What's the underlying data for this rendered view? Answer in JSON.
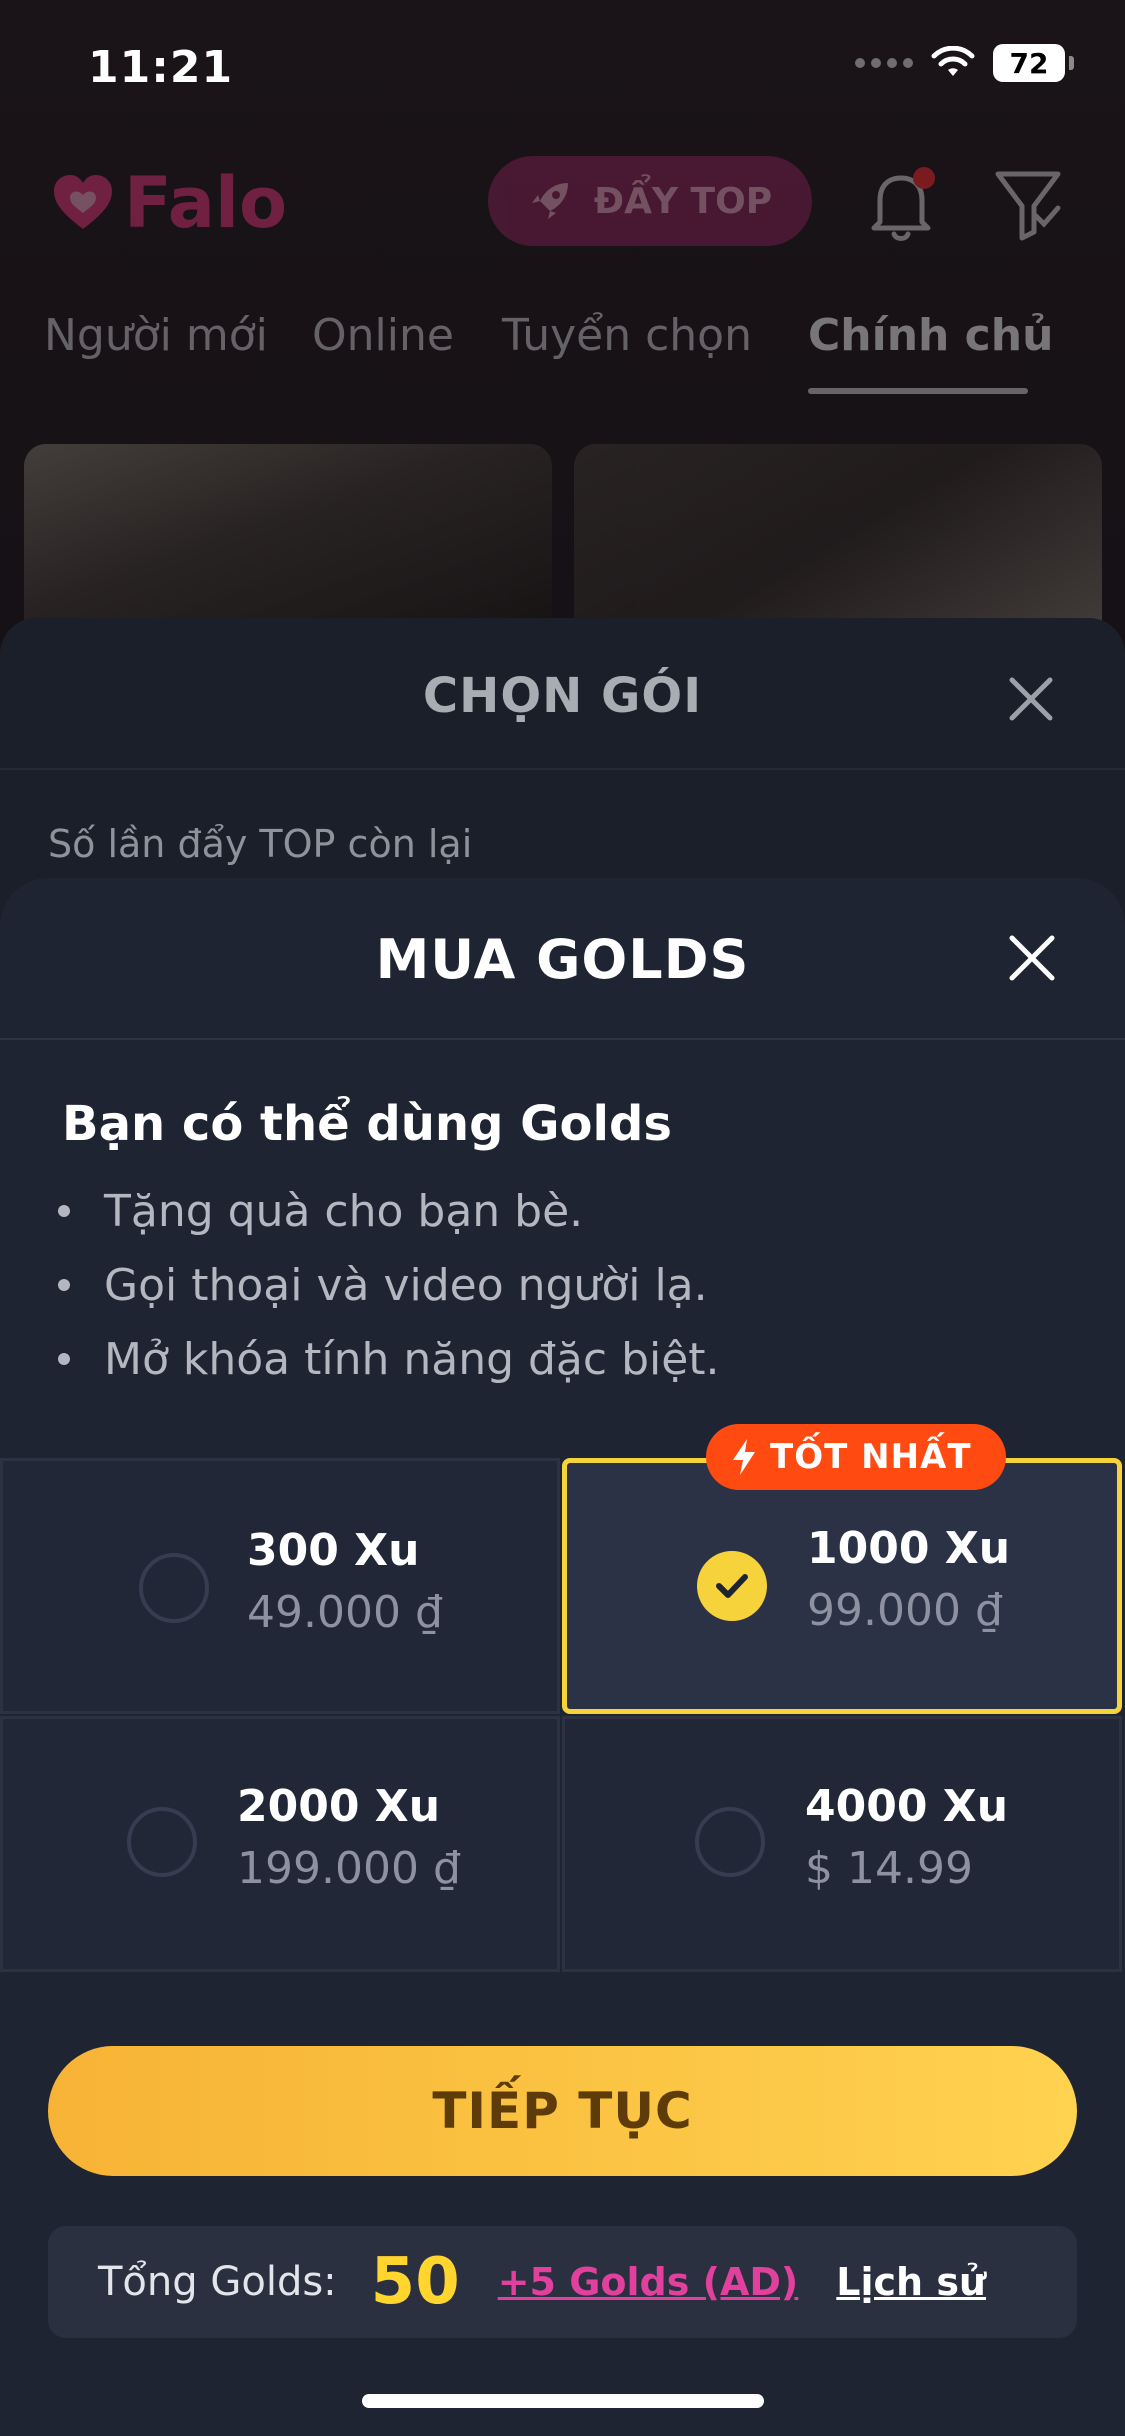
{
  "status_bar": {
    "time": "11:21",
    "battery": "72"
  },
  "app": {
    "logo_text": "Falo",
    "push_top_label": "ĐẨY TOP",
    "tabs": [
      {
        "label": "Người mới"
      },
      {
        "label": "Online"
      },
      {
        "label": "Tuyển chọn"
      },
      {
        "label": "Chính chủ",
        "active": true
      }
    ]
  },
  "choose_package_sheet": {
    "title": "CHỌN GÓI",
    "subtitle": "Số lần đẩy TOP còn lại"
  },
  "buy_golds_sheet": {
    "title": "MUA GOLDS",
    "benefits_title": "Bạn có thể dùng Golds",
    "benefits": [
      "Tặng quà cho bạn bè.",
      "Gọi thoại và video người lạ.",
      "Mở khóa tính năng đặc biệt."
    ],
    "packages": [
      {
        "amount": "300 Xu",
        "price": "49.000 ₫",
        "selected": false
      },
      {
        "amount": "1000 Xu",
        "price": "99.000 ₫",
        "selected": true,
        "badge": "TỐT NHẤT"
      },
      {
        "amount": "2000 Xu",
        "price": "199.000 ₫",
        "selected": false
      },
      {
        "amount": "4000 Xu",
        "price": "$ 14.99",
        "selected": false
      }
    ],
    "continue_label": "TIẾP TỤC",
    "total_label": "Tổng Golds:",
    "total_value": "50",
    "ad_link": "+5 Golds (AD)",
    "history_link": "Lịch sử"
  },
  "colors": {
    "accent_gold": "#f7d33b",
    "badge_orange": "#ff4b12",
    "brand_pink": "#e8347c",
    "sheet_bg": "#1f2432"
  }
}
